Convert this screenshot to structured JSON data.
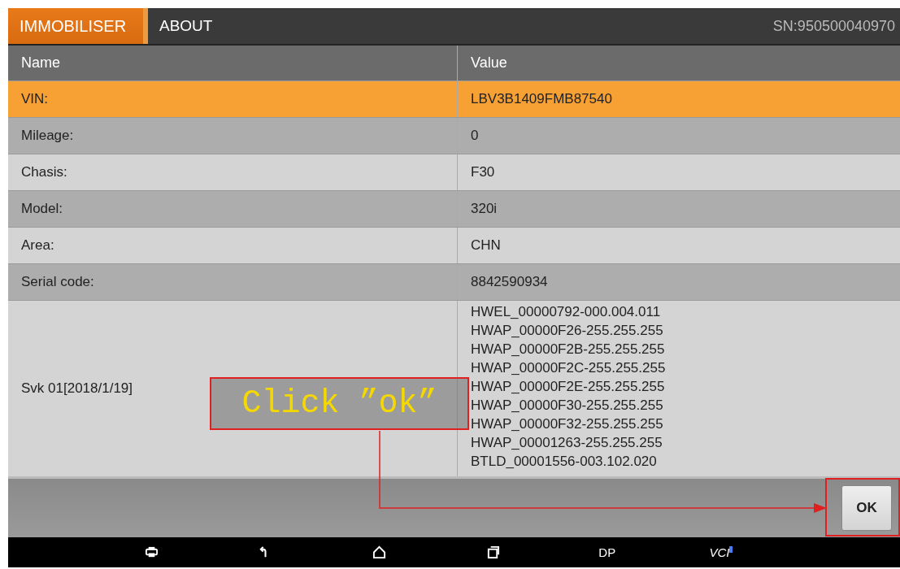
{
  "tabs": [
    {
      "label": "IMMOBILISER",
      "selected": true
    },
    {
      "label": "ABOUT",
      "selected": false
    }
  ],
  "serial_number": "SN:950500040970",
  "table": {
    "columns": [
      "Name",
      "Value"
    ],
    "rows": [
      {
        "name": "VIN:",
        "value": [
          "LBV3B1409FMB87540"
        ],
        "selected": true
      },
      {
        "name": "Mileage:",
        "value": [
          "0"
        ],
        "selected": false
      },
      {
        "name": "Chasis:",
        "value": [
          "F30"
        ],
        "selected": false
      },
      {
        "name": "Model:",
        "value": [
          "320i"
        ],
        "selected": false
      },
      {
        "name": "Area:",
        "value": [
          "CHN"
        ],
        "selected": false
      },
      {
        "name": "Serial code:",
        "value": [
          "8842590934"
        ],
        "selected": false
      },
      {
        "name": "Svk 01[2018/1/19]",
        "value": [
          "HWEL_00000792-000.004.011",
          "HWAP_00000F26-255.255.255",
          "HWAP_00000F2B-255.255.255",
          "HWAP_00000F2C-255.255.255",
          "HWAP_00000F2E-255.255.255",
          "HWAP_00000F30-255.255.255",
          "HWAP_00000F32-255.255.255",
          "HWAP_00001263-255.255.255",
          "BTLD_00001556-003.102.020"
        ],
        "selected": false
      }
    ]
  },
  "ok_button": "OK",
  "callout": "Click ”ok”",
  "nav_bar": [
    {
      "kind": "text",
      "label": "DP"
    },
    {
      "kind": "vci",
      "label": "VCI"
    }
  ]
}
